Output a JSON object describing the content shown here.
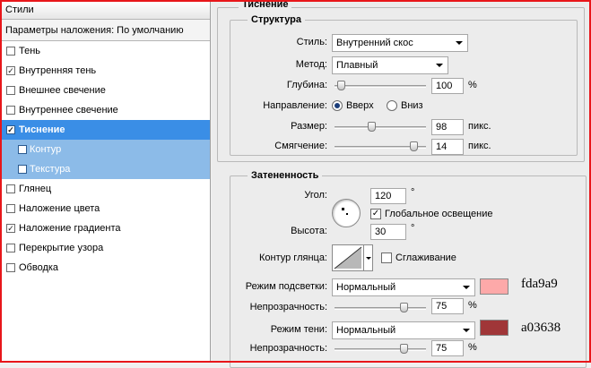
{
  "left": {
    "title": "Стили",
    "blend_options": "Параметры наложения: По умолчанию",
    "items": [
      {
        "label": "Тень",
        "checked": false,
        "sub": false,
        "state": ""
      },
      {
        "label": "Внутренняя тень",
        "checked": true,
        "sub": false,
        "state": ""
      },
      {
        "label": "Внешнее свечение",
        "checked": false,
        "sub": false,
        "state": ""
      },
      {
        "label": "Внутреннее свечение",
        "checked": false,
        "sub": false,
        "state": ""
      },
      {
        "label": "Тиснение",
        "checked": true,
        "sub": false,
        "state": "active"
      },
      {
        "label": "Контур",
        "checked": false,
        "sub": true,
        "state": "subactive"
      },
      {
        "label": "Текстура",
        "checked": false,
        "sub": true,
        "state": "subactive"
      },
      {
        "label": "Глянец",
        "checked": false,
        "sub": false,
        "state": ""
      },
      {
        "label": "Наложение цвета",
        "checked": false,
        "sub": false,
        "state": ""
      },
      {
        "label": "Наложение градиента",
        "checked": true,
        "sub": false,
        "state": ""
      },
      {
        "label": "Перекрытие узора",
        "checked": false,
        "sub": false,
        "state": ""
      },
      {
        "label": "Обводка",
        "checked": false,
        "sub": false,
        "state": ""
      }
    ]
  },
  "right": {
    "section_title": "Тиснение",
    "structure": {
      "title": "Структура",
      "style_label": "Стиль:",
      "style_value": "Внутренний скос",
      "method_label": "Метод:",
      "method_value": "Плавный",
      "depth_label": "Глубина:",
      "depth_value": "100",
      "depth_unit": "%",
      "depth_level": 0.07,
      "direction_label": "Направление:",
      "dir_up": "Вверх",
      "dir_down": "Вниз",
      "size_label": "Размер:",
      "size_value": "98",
      "size_unit": "пикс.",
      "size_level": 0.4,
      "soften_label": "Смягчение:",
      "soften_value": "14",
      "soften_unit": "пикс.",
      "soften_level": 0.86
    },
    "shading": {
      "title": "Затененность",
      "angle_label": "Угол:",
      "angle_value": "120",
      "angle_unit": "°",
      "global_light_label": "Глобальное освещение",
      "global_light_checked": true,
      "altitude_label": "Высота:",
      "altitude_value": "30",
      "altitude_unit": "°",
      "gloss_contour_label": "Контур глянца:",
      "antialias_label": "Сглаживание",
      "antialias_checked": false,
      "highlight_mode_label": "Режим подсветки:",
      "highlight_mode_value": "Нормальный",
      "highlight_color": "#fda9a9",
      "highlight_hex_label": "fda9a9",
      "highlight_opacity_label": "Непрозрачность:",
      "highlight_opacity_value": "75",
      "highlight_opacity_unit": "%",
      "highlight_opacity_level": 0.75,
      "shadow_mode_label": "Режим тени:",
      "shadow_mode_value": "Нормальный",
      "shadow_color": "#a03638",
      "shadow_hex_label": "a03638",
      "shadow_opacity_label": "Непрозрачность:",
      "shadow_opacity_value": "75",
      "shadow_opacity_unit": "%",
      "shadow_opacity_level": 0.75
    }
  }
}
